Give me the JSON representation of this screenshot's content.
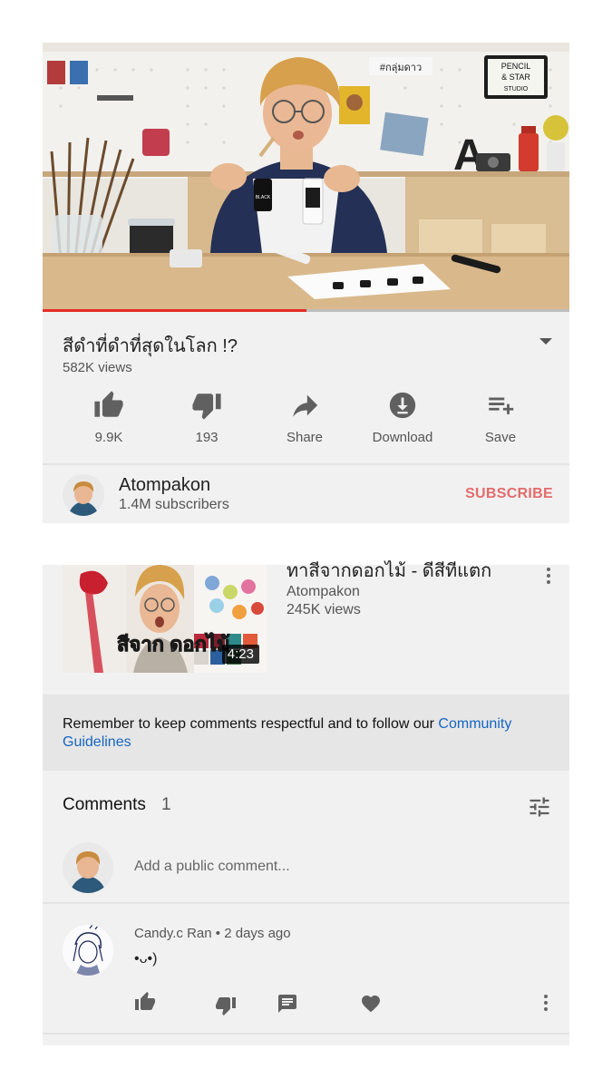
{
  "video": {
    "title": "สีดำที่ดำที่สุดในโลก !?",
    "views": "582K views",
    "progress_fraction": 0.5,
    "thumbnail_text": {
      "sign_line1": "PENCIL",
      "sign_line2": "& STAR",
      "sign_line3": "STUDIO",
      "wall_tag": "#กลุ่มดาว",
      "letter": "A",
      "bottle_label": "BLACK"
    }
  },
  "actions": [
    {
      "icon": "thumbs-up-icon",
      "label": "9.9K"
    },
    {
      "icon": "thumbs-down-icon",
      "label": "193"
    },
    {
      "icon": "share-icon",
      "label": "Share"
    },
    {
      "icon": "download-icon",
      "label": "Download"
    },
    {
      "icon": "save-playlist-icon",
      "label": "Save"
    }
  ],
  "channel": {
    "name": "Atompakon",
    "subscribers": "1.4M subscribers",
    "subscribe_label": "SUBSCRIBE"
  },
  "next_video": {
    "title": "ทาสีจากดอกไม้ - ดีสีทีแตก",
    "channel": "Atompakon",
    "views": "245K views",
    "duration": "4:23",
    "thumb_text": "สีจาก ดอกไม้"
  },
  "notice": {
    "text": "Remember to keep comments respectful and to follow our ",
    "link": "Community Guidelines"
  },
  "comments": {
    "title": "Comments",
    "count": "1",
    "placeholder": "Add a public comment...",
    "items": [
      {
        "author": "Candy.c Ran",
        "separator": "•",
        "time": "2 days ago",
        "text": "•ᴗ•)"
      }
    ]
  },
  "colors": {
    "panel_bg": "#f1f1f1",
    "progress_red": "#e52d27",
    "subscribe_red": "#e36b6b",
    "link_blue": "#1565c0"
  }
}
